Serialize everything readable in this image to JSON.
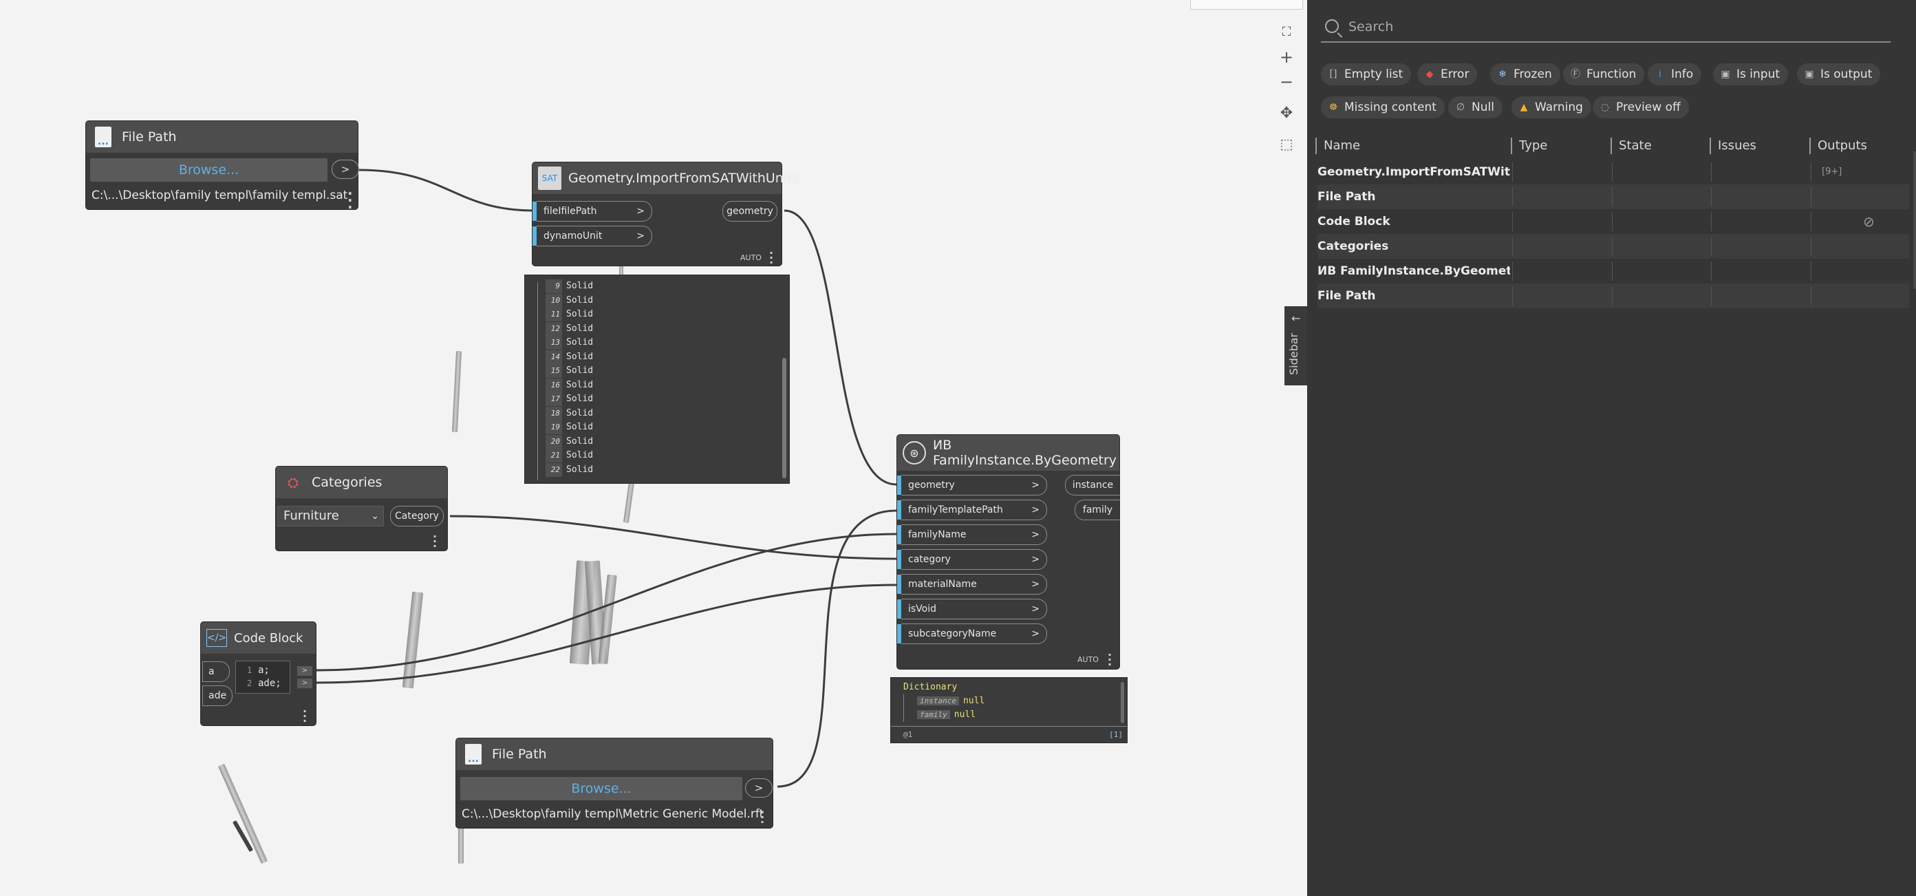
{
  "nodes": {
    "file_path_1": {
      "title": "File Path",
      "browse": "Browse...",
      "path": "C:\\...\\Desktop\\family templ\\family templ.sat",
      "out": ">"
    },
    "import_sat": {
      "title": "Geometry.ImportFromSATWithUnits",
      "inputs": [
        "fileIfilePath",
        "dynamoUnit"
      ],
      "output": "geometry",
      "lacing": "AUTO",
      "preview": [
        {
          "i": "9",
          "v": "Solid"
        },
        {
          "i": "10",
          "v": "Solid"
        },
        {
          "i": "11",
          "v": "Solid"
        },
        {
          "i": "12",
          "v": "Solid"
        },
        {
          "i": "13",
          "v": "Solid"
        },
        {
          "i": "14",
          "v": "Solid"
        },
        {
          "i": "15",
          "v": "Solid"
        },
        {
          "i": "16",
          "v": "Solid"
        },
        {
          "i": "17",
          "v": "Solid"
        },
        {
          "i": "18",
          "v": "Solid"
        },
        {
          "i": "19",
          "v": "Solid"
        },
        {
          "i": "20",
          "v": "Solid"
        },
        {
          "i": "21",
          "v": "Solid"
        },
        {
          "i": "22",
          "v": "Solid"
        }
      ]
    },
    "categories": {
      "title": "Categories",
      "selected": "Furniture",
      "output": "Category"
    },
    "code_block": {
      "title": "Code Block",
      "inputs": [
        "a",
        "ade"
      ],
      "lines": [
        "a;",
        "ade;"
      ],
      "line_numbers": [
        "1",
        "2"
      ]
    },
    "family_instance": {
      "title": "ИВ FamilyInstance.ByGeometry",
      "inputs": [
        "geometry",
        "familyTemplatePath",
        "familyName",
        "category",
        "materialName",
        "isVoid",
        "subcategoryName"
      ],
      "outputs": [
        "instance",
        "family"
      ],
      "lacing": "AUTO",
      "preview": {
        "type": "Dictionary",
        "keys": [
          {
            "k": "instance",
            "v": "null"
          },
          {
            "k": "family",
            "v": "null"
          }
        ],
        "footer_left": "@1",
        "footer_right": "[1]"
      }
    },
    "file_path_2": {
      "title": "File Path",
      "browse": "Browse...",
      "path": "C:\\...\\Desktop\\family templ\\Metric Generic Model.rft",
      "out": ">"
    }
  },
  "sidebar_toggle": "Sidebar",
  "panel": {
    "search_placeholder": "Search",
    "filters": [
      {
        "label": "Empty list",
        "icon": "[]",
        "color": "#bbbbbb"
      },
      {
        "label": "Error",
        "icon": "◆",
        "color": "#e05252"
      },
      {
        "label": "Frozen",
        "icon": "❄",
        "color": "#8fc3ef"
      },
      {
        "label": "Function",
        "icon": "Ⓕ",
        "color": "#bbbbbb"
      },
      {
        "label": "Info",
        "icon": "i",
        "color": "#3d9ae8"
      },
      {
        "label": "Is input",
        "icon": "▣",
        "color": "#bbbbbb"
      },
      {
        "label": "Is output",
        "icon": "▣",
        "color": "#bbbbbb"
      },
      {
        "label": "Missing content",
        "icon": "☸",
        "color": "#e0b44a"
      },
      {
        "label": "Null",
        "icon": "∅",
        "color": "#bbbbbb"
      },
      {
        "label": "Warning",
        "icon": "▲",
        "color": "#f0b429"
      },
      {
        "label": "Preview off",
        "icon": "◌",
        "color": "#bbbbbb"
      }
    ],
    "columns": [
      "Name",
      "Type",
      "State",
      "Issues",
      "Outputs"
    ],
    "rows": [
      {
        "name": "Geometry.ImportFromSATWithUnits",
        "output": "[9+]"
      },
      {
        "name": "File Path",
        "output": ""
      },
      {
        "name": "Code Block",
        "output": "⊘"
      },
      {
        "name": "Categories",
        "output": ""
      },
      {
        "name": "ИВ FamilyInstance.ByGeometry",
        "output": ""
      },
      {
        "name": "File Path",
        "output": ""
      }
    ]
  },
  "colors": {
    "port_blue": "#5eb4e0",
    "node_bg": "#3a3a3a",
    "header_bg": "#4d4d4d",
    "panel_bg": "#353535"
  }
}
